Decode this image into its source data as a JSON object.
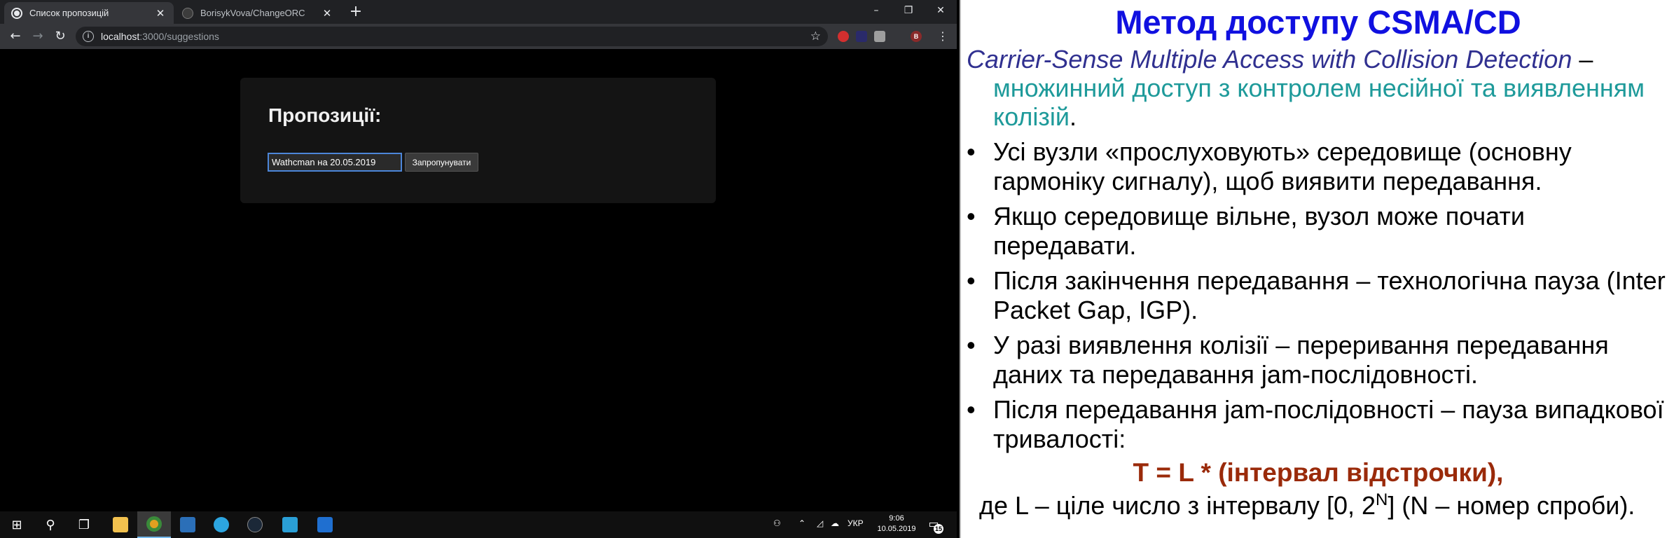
{
  "browser": {
    "tabs": [
      {
        "title": "Список пропозицій",
        "active": true
      },
      {
        "title": "BorisykVova/ChangeORC",
        "active": false
      }
    ],
    "new_tab_label": "+",
    "window_controls": {
      "minimize": "–",
      "restore": "❐",
      "close": "✕"
    },
    "nav": {
      "back": "←",
      "forward": "→",
      "reload": "↻"
    },
    "omnibox": {
      "info_glyph": "i",
      "host": "localhost",
      "rest": ":3000/suggestions",
      "star": "☆"
    },
    "extensions": [
      {
        "name": "adblock-icon",
        "color": "#d32f2f"
      },
      {
        "name": "play-extension-icon",
        "color": "#2a2a6a"
      },
      {
        "name": "extension-icon",
        "color": "#9e9e9e"
      },
      {
        "name": "profile-avatar",
        "color": "#8a2a2a",
        "letter": "B"
      }
    ],
    "menu_glyph": "⋮"
  },
  "page": {
    "heading": "Пропозиції:",
    "suggestion_value": "Wathcman на 20.05.2019",
    "skip_label": "Запропунувати"
  },
  "taskbar": {
    "apps": [
      {
        "name": "start-button",
        "glyph": "⊞"
      },
      {
        "name": "search-icon",
        "glyph": "⚲"
      },
      {
        "name": "task-view-icon",
        "glyph": "❐"
      },
      {
        "name": "file-explorer-icon",
        "color": "#f2c14e"
      },
      {
        "name": "chrome-icon",
        "color": "#e0a020",
        "active": true
      },
      {
        "name": "app-icon",
        "color": "#2b6fb8"
      },
      {
        "name": "telegram-icon",
        "color": "#2ca5e0"
      },
      {
        "name": "steam-icon",
        "color": "#1b2838"
      },
      {
        "name": "webstorm-icon",
        "color": "#2a9fd6"
      },
      {
        "name": "document-icon",
        "color": "#1f6fd0"
      }
    ],
    "tray": {
      "lang": "УКР",
      "time": "9:06",
      "date": "10.05.2019",
      "notifications": "15"
    }
  },
  "slide": {
    "title": "Метод доступу CSMA/CD",
    "definition_en": "Carrier-Sense Multiple Access with Collision Detection",
    "definition_dash": " –",
    "definition_ua": "множинний доступ з контролем несійної та виявленням колізій",
    "definition_end": ".",
    "bullet_glyph": "•",
    "bullets": [
      "Усі вузли «прослуховують» середовище (основну гармоніку сигналу), щоб виявити передавання.",
      "Якщо середовище вільне, вузол може почати передавати.",
      "Після закінчення передавання – технологічна пауза (Inter Packet Gap, IGP).",
      "У разі виявлення колізії – переривання передавання даних та передавання jam-послідовності.",
      "Після передавання jam-послідовності – пауза випадкової тривалості:"
    ],
    "formula": "T = L * (інтервал відстрочки)",
    "formula_comma": ",",
    "where_pre": "де L – ціле число з інтервалу [0, 2",
    "where_sup": "N",
    "where_post": "] (N – номер спроби)."
  }
}
